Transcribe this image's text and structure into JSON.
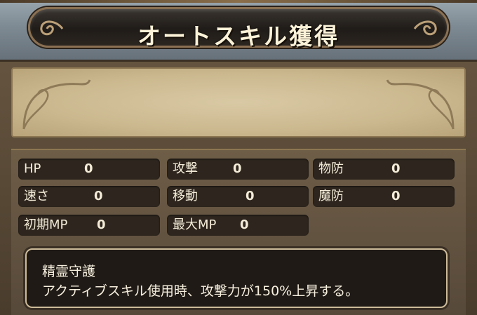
{
  "header": {
    "title": "オートスキル獲得"
  },
  "stats": [
    {
      "label": "HP",
      "value": "0"
    },
    {
      "label": "攻撃",
      "value": "0"
    },
    {
      "label": "物防",
      "value": "0"
    },
    {
      "label": "速さ",
      "value": "0"
    },
    {
      "label": "移動",
      "value": "0"
    },
    {
      "label": "魔防",
      "value": "0"
    },
    {
      "label": "初期MP",
      "value": "0"
    },
    {
      "label": "最大MP",
      "value": "0"
    }
  ],
  "skill": {
    "name": "精霊守護",
    "description": "アクティブスキル使用時、攻撃力が150%上昇する。"
  },
  "colors": {
    "accent": "#8a7052",
    "panel": "#2e261e",
    "text": "#f4ecd8"
  }
}
